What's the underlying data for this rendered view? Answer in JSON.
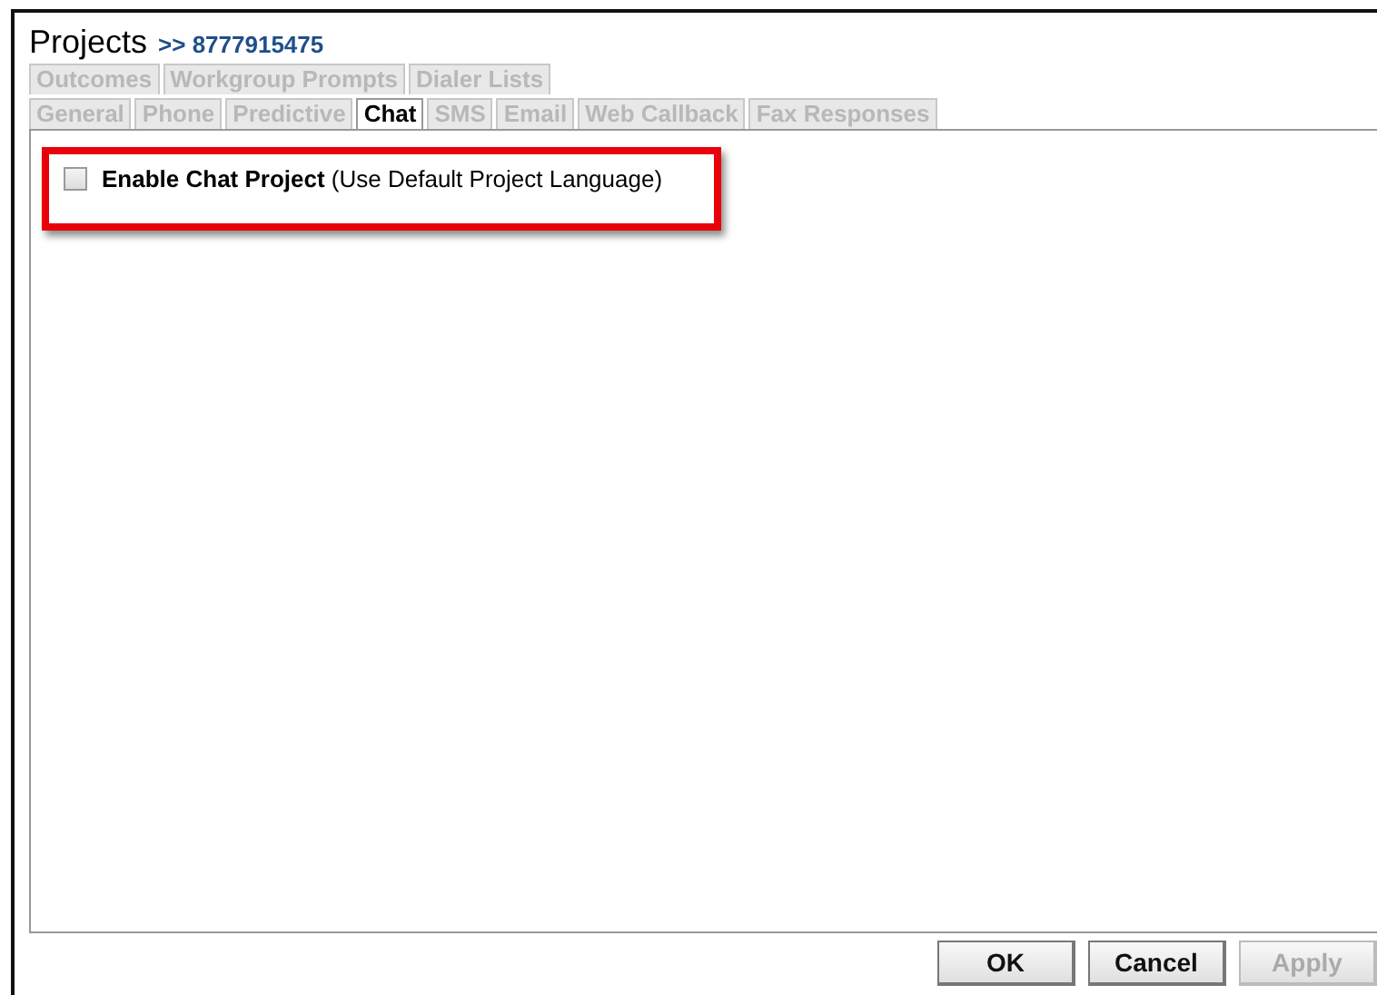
{
  "header": {
    "title": "Projects",
    "breadcrumb": ">> 8777915475"
  },
  "tab_rows": [
    [
      {
        "label": "Outcomes",
        "selected": false
      },
      {
        "label": "Workgroup Prompts",
        "selected": false
      },
      {
        "label": "Dialer Lists",
        "selected": false
      }
    ],
    [
      {
        "label": "General",
        "selected": false
      },
      {
        "label": "Phone",
        "selected": false
      },
      {
        "label": "Predictive",
        "selected": false
      },
      {
        "label": "Chat",
        "selected": true
      },
      {
        "label": "SMS",
        "selected": false
      },
      {
        "label": "Email",
        "selected": false
      },
      {
        "label": "Web Callback",
        "selected": false
      },
      {
        "label": "Fax Responses",
        "selected": false
      }
    ]
  ],
  "option": {
    "label": "**Enable Chat Project** (Use Default Project Language)",
    "checked": false,
    "highlighted": true
  },
  "buttons": [
    {
      "label": "OK",
      "disabled": false
    },
    {
      "label": "Cancel",
      "disabled": false
    },
    {
      "label": "Apply",
      "disabled": true
    }
  ]
}
